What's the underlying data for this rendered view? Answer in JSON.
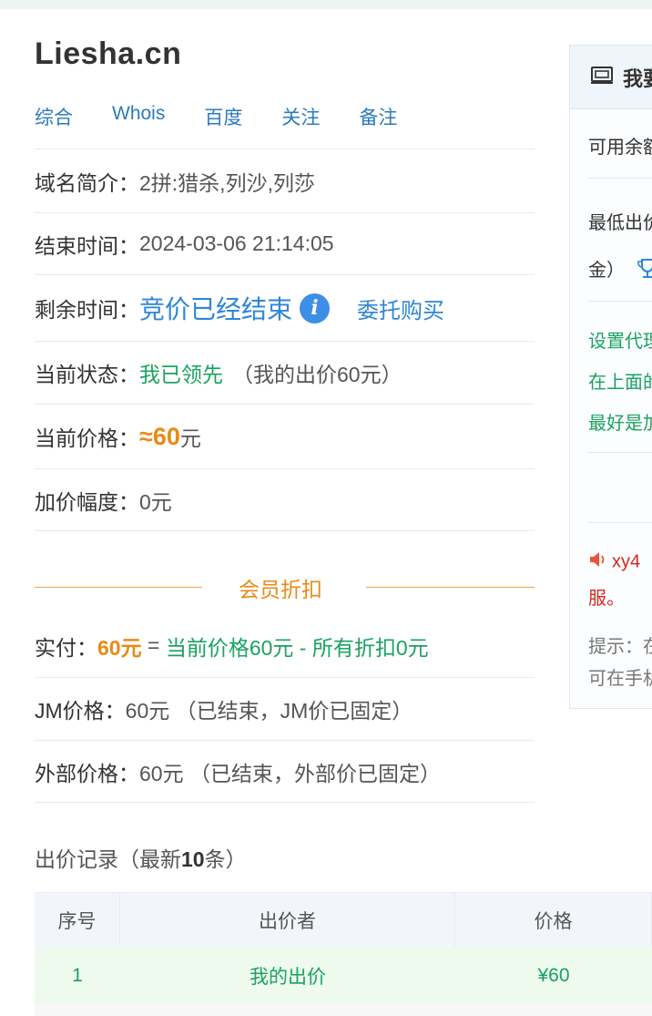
{
  "domain": "Liesha.cn",
  "links": [
    "综合",
    "Whois",
    "百度",
    "关注",
    "备注"
  ],
  "info": {
    "intro_label": "域名简介：",
    "intro_value": "2拼:猎杀,列沙,列莎",
    "end_label": "结束时间：",
    "end_value": "2024-03-06 21:14:05",
    "remain_label": "剩余时间：",
    "remain_value": "竞价已经结束",
    "entrust": "委托购买",
    "status_label": "当前状态：",
    "status_value": "我已领先",
    "status_note": "（我的出价60元）",
    "price_label": "当前价格：",
    "price_value": "≈60",
    "price_unit": "元",
    "increment_label": "加价幅度：",
    "increment_value": "0元"
  },
  "member": {
    "title": "会员折扣",
    "pay_label": "实付：",
    "pay_value": "60元",
    "pay_eq": " = ",
    "pay_formula": "当前价格60元 - 所有折扣0元",
    "jm_label": "JM价格：",
    "jm_value": "60元 （已结束，JM价已固定）",
    "ext_label": "外部价格：",
    "ext_value": "60元 （已结束，外部价已固定）"
  },
  "records": {
    "title_pre": "出价记录（最新",
    "title_num": "10",
    "title_post": "条）",
    "headers": [
      "序号",
      "出价者",
      "价格"
    ],
    "rows": [
      {
        "no": "1",
        "bidder": "我的出价",
        "price": "¥60"
      }
    ]
  },
  "panel": {
    "title": "我要",
    "balance": "可用余额",
    "min_bid": "最低出价",
    "deposit": "金）",
    "tip1": "设置代理",
    "tip2": "在上面的",
    "tip3": "最好是加",
    "notice1": "xy4",
    "notice2": "服。",
    "hint1": "提示：在",
    "hint2": "可在手机"
  },
  "colors": {
    "link": "#2b7bbd",
    "green": "#1aa260",
    "orange": "#e98a17",
    "blue": "#2e86d6",
    "red": "#d9251c"
  }
}
